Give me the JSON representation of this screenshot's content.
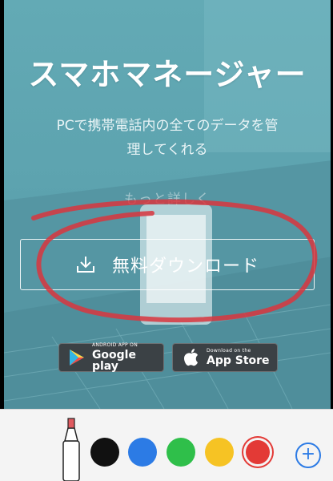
{
  "hero": {
    "title": "スマホマネージャー",
    "subtitle_line1": "PCで携帯電話内の全てのデータを管",
    "subtitle_line2": "理してくれる",
    "faded_text": "もっと詳しく",
    "download_label": "無料ダウンロード",
    "google_play": {
      "small": "ANDROID APP ON",
      "big": "Google play"
    },
    "app_store": {
      "small": "Download on the",
      "big": "App Store"
    }
  },
  "annotation": {
    "color": "#d9363e",
    "shape": "ellipse"
  },
  "toolbar": {
    "tool": "marker-pen",
    "colors": [
      "#111111",
      "#2c7be5",
      "#2fbf4a",
      "#f6c324",
      "#e33a36"
    ],
    "selected_color": "#e33a36",
    "add_label": "+"
  }
}
